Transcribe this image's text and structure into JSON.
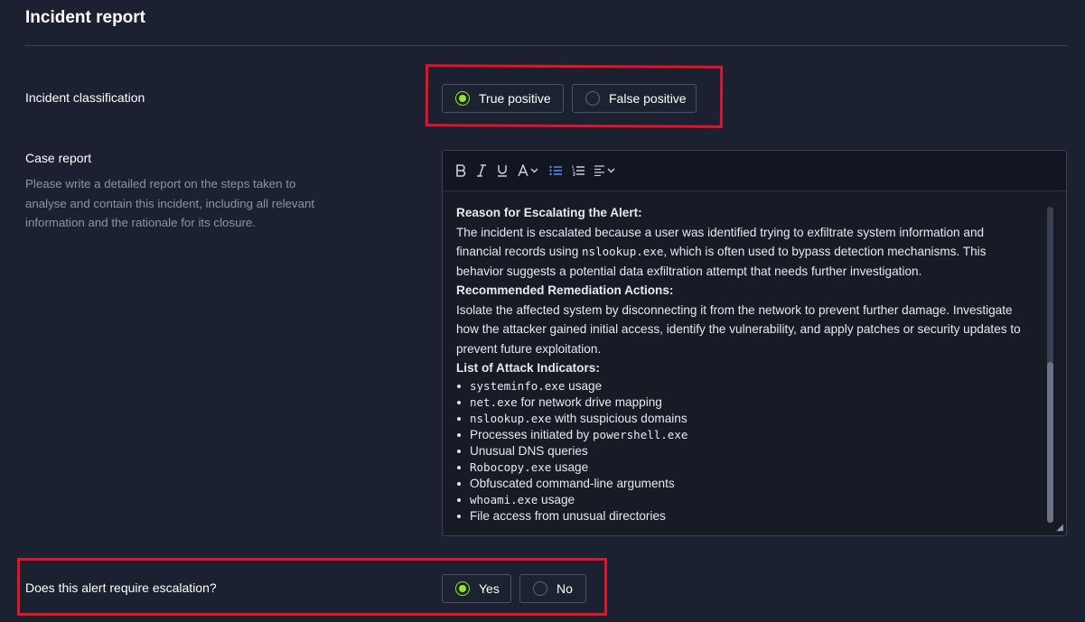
{
  "header": {
    "title": "Incident report"
  },
  "classification": {
    "label": "Incident classification",
    "options": [
      {
        "label": "True positive",
        "selected": true
      },
      {
        "label": "False positive",
        "selected": false
      }
    ]
  },
  "case_report": {
    "label": "Case report",
    "description": "Please write a detailed report on the steps taken to analyse and contain this incident, including all relevant information and the rationale for its closure.",
    "toolbar": [
      "bold-icon",
      "italic-icon",
      "underline-icon",
      "text-color-icon",
      "bullet-list-icon",
      "numbered-list-icon",
      "align-icon"
    ],
    "content": {
      "heading1": "Reason for Escalating the Alert:",
      "para1_a": "The incident is escalated because a user was identified trying to exfiltrate system information and financial records using ",
      "para1_code": "nslookup.exe",
      "para1_b": ", which is often used to bypass detection mechanisms. This behavior suggests a potential data exfiltration attempt that needs further investigation.",
      "heading2": "Recommended Remediation Actions:",
      "para2": "Isolate the affected system by disconnecting it from the network to prevent further damage. Investigate how the attacker gained initial access, identify the vulnerability, and apply patches or security updates to prevent future exploitation.",
      "heading3": "List of Attack Indicators:",
      "indicators": [
        {
          "code": "systeminfo.exe",
          "text": " usage"
        },
        {
          "code": "net.exe",
          "text": " for network drive mapping"
        },
        {
          "code": "nslookup.exe",
          "text": " with suspicious domains"
        },
        {
          "pre": "Processes initiated by ",
          "code": "powershell.exe",
          "text": ""
        },
        {
          "pre": "Unusual DNS queries",
          "code": "",
          "text": ""
        },
        {
          "code": "Robocopy.exe",
          "text": " usage"
        },
        {
          "pre": "Obfuscated command-line arguments",
          "code": "",
          "text": ""
        },
        {
          "code": "whoami.exe",
          "text": " usage"
        },
        {
          "pre": "File access from unusual directories",
          "code": "",
          "text": ""
        }
      ]
    }
  },
  "escalation": {
    "label": "Does this alert require escalation?",
    "options": [
      {
        "label": "Yes",
        "selected": true
      },
      {
        "label": "No",
        "selected": false
      }
    ]
  },
  "colors": {
    "background": "#1b2130",
    "accent": "#9ae32c",
    "highlight": "#e0142b"
  }
}
